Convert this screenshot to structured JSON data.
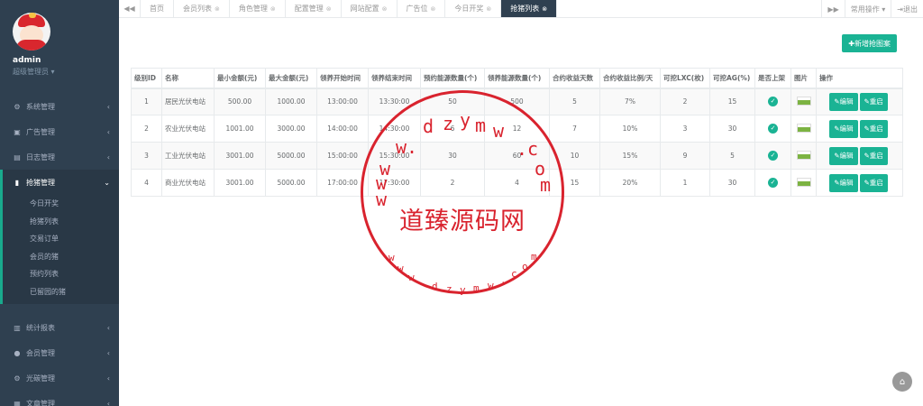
{
  "user": {
    "name": "admin",
    "role": "超级管理员 ▾"
  },
  "sidebar": {
    "items": [
      {
        "label": "系统管理",
        "icon": "gear-icon",
        "glyph": "⚙"
      },
      {
        "label": "广告管理",
        "icon": "image-icon",
        "glyph": "▣"
      },
      {
        "label": "日志管理",
        "icon": "log-icon",
        "glyph": "▤"
      },
      {
        "label": "抢猪管理",
        "icon": "book-icon",
        "glyph": "▮"
      }
    ],
    "submenu": [
      "今日开奖",
      "抢猪列表",
      "交易订单",
      "会员的猪",
      "预约列表",
      "已留园的猪"
    ],
    "items2": [
      {
        "label": "统计报表",
        "icon": "chart-icon",
        "glyph": "▥"
      },
      {
        "label": "会员管理",
        "icon": "user-icon",
        "glyph": "●"
      },
      {
        "label": "光碳管理",
        "icon": "gear-icon",
        "glyph": "⚙"
      },
      {
        "label": "文章管理",
        "icon": "article-icon",
        "glyph": "▦"
      }
    ]
  },
  "tabs": [
    "首页",
    "会员列表",
    "角色管理",
    "配置管理",
    "网站配置",
    "广告位",
    "今日开奖",
    "抢猪列表"
  ],
  "tabbar": {
    "prev": "◀◀",
    "next": "▶▶",
    "ops": "常用操作 ▾",
    "logout": "⇥退出"
  },
  "actions": {
    "add": "✚新增抢图案"
  },
  "table": {
    "headers": [
      "级别ID",
      "名称",
      "最小金额(元)",
      "最大金额(元)",
      "领养开始时间",
      "领养结束时间",
      "预约能源数量(个)",
      "领养能源数量(个)",
      "合约收益天数",
      "合约收益比例/天",
      "可挖LXC(枚)",
      "可挖AG(%)",
      "是否上架",
      "图片",
      "操作"
    ],
    "rows": [
      [
        "1",
        "居民光伏电站",
        "500.00",
        "1000.00",
        "13:00:00",
        "13:30:00",
        "50",
        "500",
        "5",
        "7%",
        "2",
        "15"
      ],
      [
        "2",
        "农业光伏电站",
        "1001.00",
        "3000.00",
        "14:00:00",
        "14:30:00",
        "6",
        "12",
        "7",
        "10%",
        "3",
        "30"
      ],
      [
        "3",
        "工业光伏电站",
        "3001.00",
        "5000.00",
        "15:00:00",
        "15:30:00",
        "30",
        "60",
        "10",
        "15%",
        "9",
        "5"
      ],
      [
        "4",
        "商业光伏电站",
        "3001.00",
        "5000.00",
        "17:00:00",
        "17:30:00",
        "2",
        "4",
        "15",
        "20%",
        "1",
        "30"
      ]
    ],
    "edit_label": "✎编辑",
    "restart_label": "✎重启"
  },
  "watermark": {
    "text": "道臻源码网",
    "url_top": "www.dzym.com",
    "url_bottom": "www.dzym.com"
  },
  "colors": {
    "sidebar": "#2f4050",
    "accent": "#1ab394",
    "stamp": "#d9232e"
  }
}
